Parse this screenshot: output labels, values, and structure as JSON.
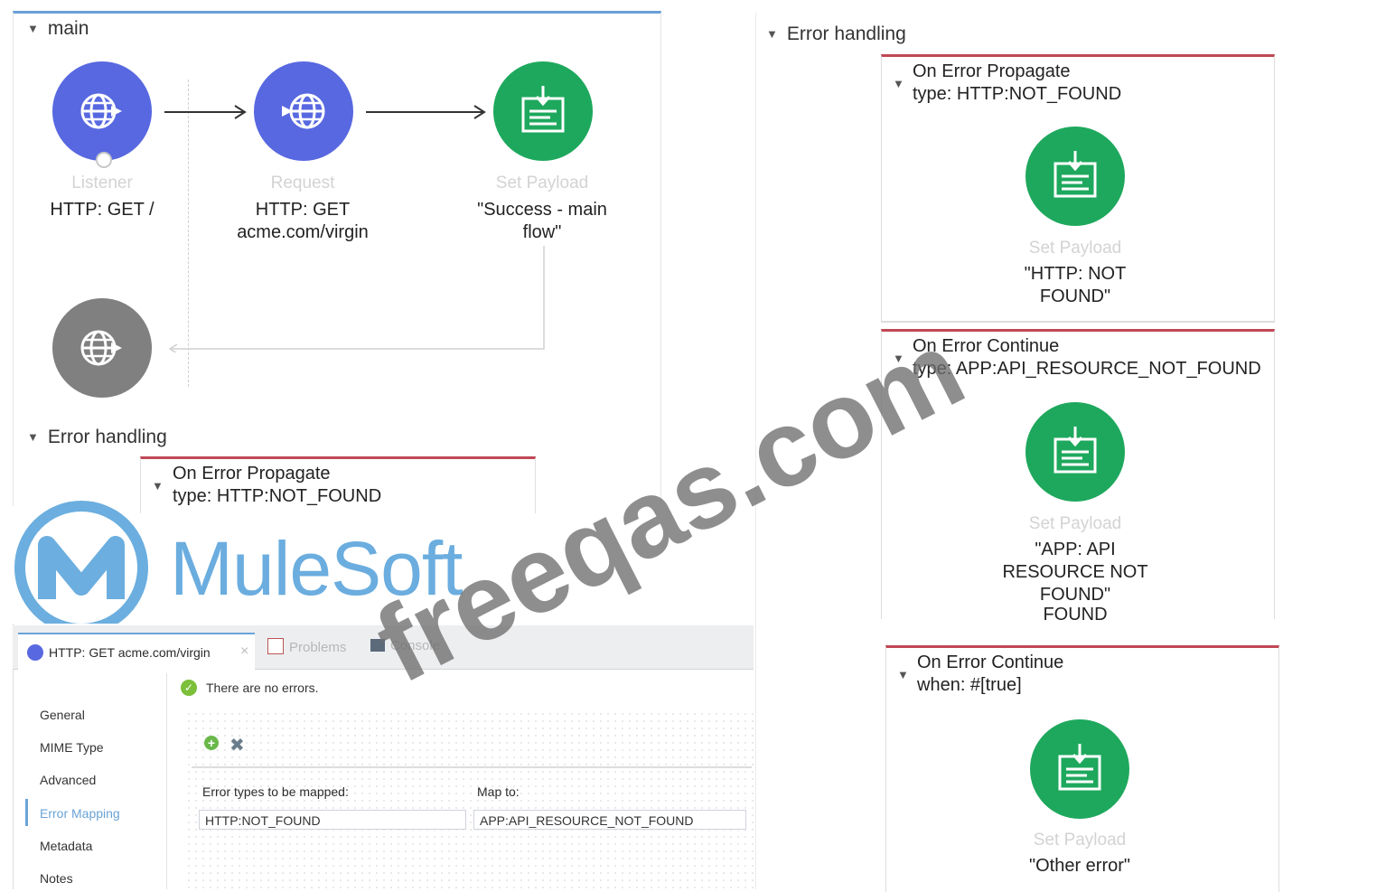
{
  "main_flow": {
    "title": "main",
    "listener": {
      "kind": "Listener",
      "value": "HTTP: GET /"
    },
    "request": {
      "kind": "Request",
      "value_line1": "HTTP: GET",
      "value_line2": "acme.com/virgin"
    },
    "set_payload": {
      "kind": "Set Payload",
      "value_line1": "\"Success - main",
      "value_line2": "flow\""
    },
    "error_handling": {
      "title": "Error handling",
      "scope": {
        "line1": "On Error Propagate",
        "line2": "type: HTTP:NOT_FOUND"
      }
    }
  },
  "logo": {
    "text": "MuleSoft",
    "brand_color": "#5ba5dc"
  },
  "editor": {
    "tabs": [
      {
        "label": "HTTP: GET acme.com/virgin",
        "close": "×"
      },
      {
        "label": "Problems"
      },
      {
        "label": "Console"
      }
    ],
    "status": "There are no errors.",
    "sidebar": [
      "General",
      "MIME Type",
      "Advanced",
      "Error Mapping",
      "Metadata",
      "Notes"
    ],
    "mapping": {
      "col1_header": "Error types to be mapped:",
      "col2_header": "Map to:",
      "col1_value": "HTTP:NOT_FOUND",
      "col2_value": "APP:API_RESOURCE_NOT_FOUND"
    }
  },
  "right_error_handling": {
    "title": "Error handling",
    "scopes": [
      {
        "line1": "On Error Propagate",
        "line2": "type: HTTP:NOT_FOUND",
        "kind": "Set Payload",
        "val1": "\"HTTP: NOT",
        "val2": "FOUND\""
      },
      {
        "line1": "On Error Continue",
        "line2": "type: APP:API_RESOURCE_NOT_FOUND",
        "kind": "Set Payload",
        "val1": "\"APP: API",
        "val2": "RESOURCE NOT",
        "val3": "FOUND\"",
        "overflow": "FOUND"
      },
      {
        "line1": "On Error Continue",
        "line2": "when: #[true]",
        "kind": "Set Payload",
        "val1": "\"Other error\""
      }
    ]
  },
  "watermark": {
    "text": "freeqas.com"
  },
  "colors": {
    "http_node": "#5868e0",
    "payload_node": "#1ea85d",
    "end_node": "#808080",
    "scope_border": "#c04855"
  }
}
